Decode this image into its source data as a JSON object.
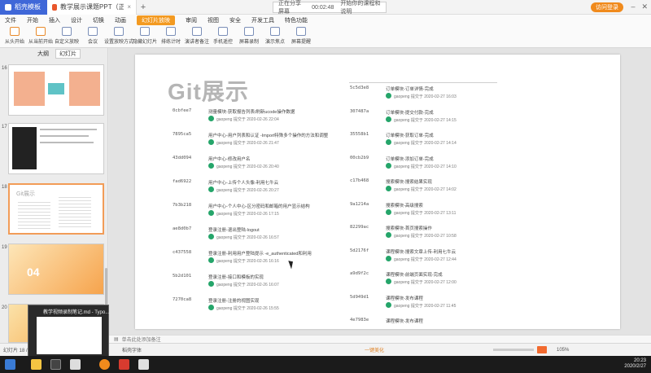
{
  "titlebar": {
    "home_tab": "稻壳模板",
    "doc_tab": "教学展示课题PPT（正文稿）",
    "meeting_label": "正在分享屏幕",
    "meeting_time": "00:02:48",
    "meeting_action": "开始你的课程和说明",
    "login_button": "访问登录"
  },
  "menu": [
    "文件",
    "开始",
    "插入",
    "设计",
    "切换",
    "动画",
    "幻灯片放映",
    "审阅",
    "视图",
    "安全",
    "开发工具",
    "特色功能"
  ],
  "menu_active": "幻灯片放映",
  "ribbon": [
    "从头开始",
    "从当前开始",
    "自定义放映",
    "会议",
    "设置放映方式",
    "隐藏幻灯片",
    "排练计时",
    "演讲者备注",
    "手机遥控",
    "屏幕录制",
    "演示焦点",
    "屏幕提醒"
  ],
  "left_panel": {
    "tabs": [
      "大纲",
      "幻灯片"
    ],
    "slide_numbers": [
      "16",
      "17",
      "18",
      "19",
      "20"
    ]
  },
  "slide": {
    "title": "Git展示",
    "left_commits": [
      {
        "hash": "0cbfee7",
        "msg": "测量模块-获取报告列表/刷新ucode操作数据",
        "meta": "gaopeng 提交于 2020-02-26 22:04"
      },
      {
        "hash": "7895ca5",
        "msg": "用户中心-用户列表和认证 -Import特殊多个操作的方法和调整",
        "meta": "gaopeng 提交于 2020-02-26 21:47"
      },
      {
        "hash": "43dd094",
        "msg": "用户中心-修改用户名",
        "meta": "gaopeng 提交于 2020-02-26 20:40"
      },
      {
        "hash": "fad6922",
        "msg": "用户中心-上传个人头像-利用七牛云",
        "meta": "gaopeng 提交于 2020-02-26 20:27"
      },
      {
        "hash": "7b3b218",
        "msg": "用户中心-个人中心-区分密码和邮箱的用户显示结构",
        "meta": "gaopeng 提交于 2020-02-26 17:15"
      },
      {
        "hash": "ae8d0b7",
        "msg": "登录注册-退出登陆-logout",
        "meta": "gaopeng 提交于 2020-02-26 16:57"
      },
      {
        "hash": "c437558",
        "msg": "登录注册-利用用户登陆提示 -e_authenticated和利用",
        "meta": "gaopeng 提交于 2020-02-26 16:16"
      },
      {
        "hash": "5b2d101",
        "msg": "登录注册-接口和模板的实现",
        "meta": "gaopeng 提交于 2020-02-26 16:07"
      },
      {
        "hash": "7270ca8",
        "msg": "登录注册-注册的视图实现",
        "meta": "gaopeng 提交于 2020-02-26 15:55"
      }
    ],
    "right_commits": [
      {
        "hash": "5c5d3e8",
        "msg": "订单模块-订单详情-完成",
        "meta": "gaopeng 提交于 2020-02-27 16:03"
      },
      {
        "hash": "307487a",
        "msg": "订单模块-提交付款-完成",
        "meta": "gaopeng 提交于 2020-02-27 14:15"
      },
      {
        "hash": "35558b1",
        "msg": "订单模块-获取订单-完成",
        "meta": "gaopeng 提交于 2020-02-27 14:14"
      },
      {
        "hash": "00cb2b9",
        "msg": "订单模块-添加订单-完成",
        "meta": "gaopeng 提交于 2020-02-27 14:10"
      },
      {
        "hash": "c17b468",
        "msg": "搜索模块-搜索结果实现",
        "meta": "gaopeng 提交于 2020-02-27 14:02"
      },
      {
        "hash": "9a1214a",
        "msg": "搜索模块-高级搜索",
        "meta": "gaopeng 提交于 2020-02-27 13:11"
      },
      {
        "hash": "82299ac",
        "msg": "搜索模块-首页搜索操作",
        "meta": "gaopeng 提交于 2020-02-27 10:58"
      },
      {
        "hash": "5d2176f",
        "msg": "课程模块-搜索文章上传-利用七牛云",
        "meta": "gaopeng 提交于 2020-02-27 12:44"
      },
      {
        "hash": "a9d9f2c",
        "msg": "课程模块-前端页面实现-完成",
        "meta": "gaopeng 提交于 2020-02-27 12:00"
      },
      {
        "hash": "5d949d1",
        "msg": "课程模块-发布课程",
        "meta": "gaopeng 提交于 2020-02-27 11:45"
      },
      {
        "hash": "4e7983e",
        "msg": "课程模块-发布课程",
        "meta": ""
      }
    ]
  },
  "notes_placeholder": "单击此处添加备注",
  "status": {
    "slide_counter": "幻灯片 18 / 20",
    "theme": "稻壳字体",
    "beautify": "一键美化",
    "zoom": "105%"
  },
  "preview_title": "教学视频录制笔记.md - Typo...",
  "clock": {
    "time": "20:23",
    "date": "2020/2/27"
  }
}
